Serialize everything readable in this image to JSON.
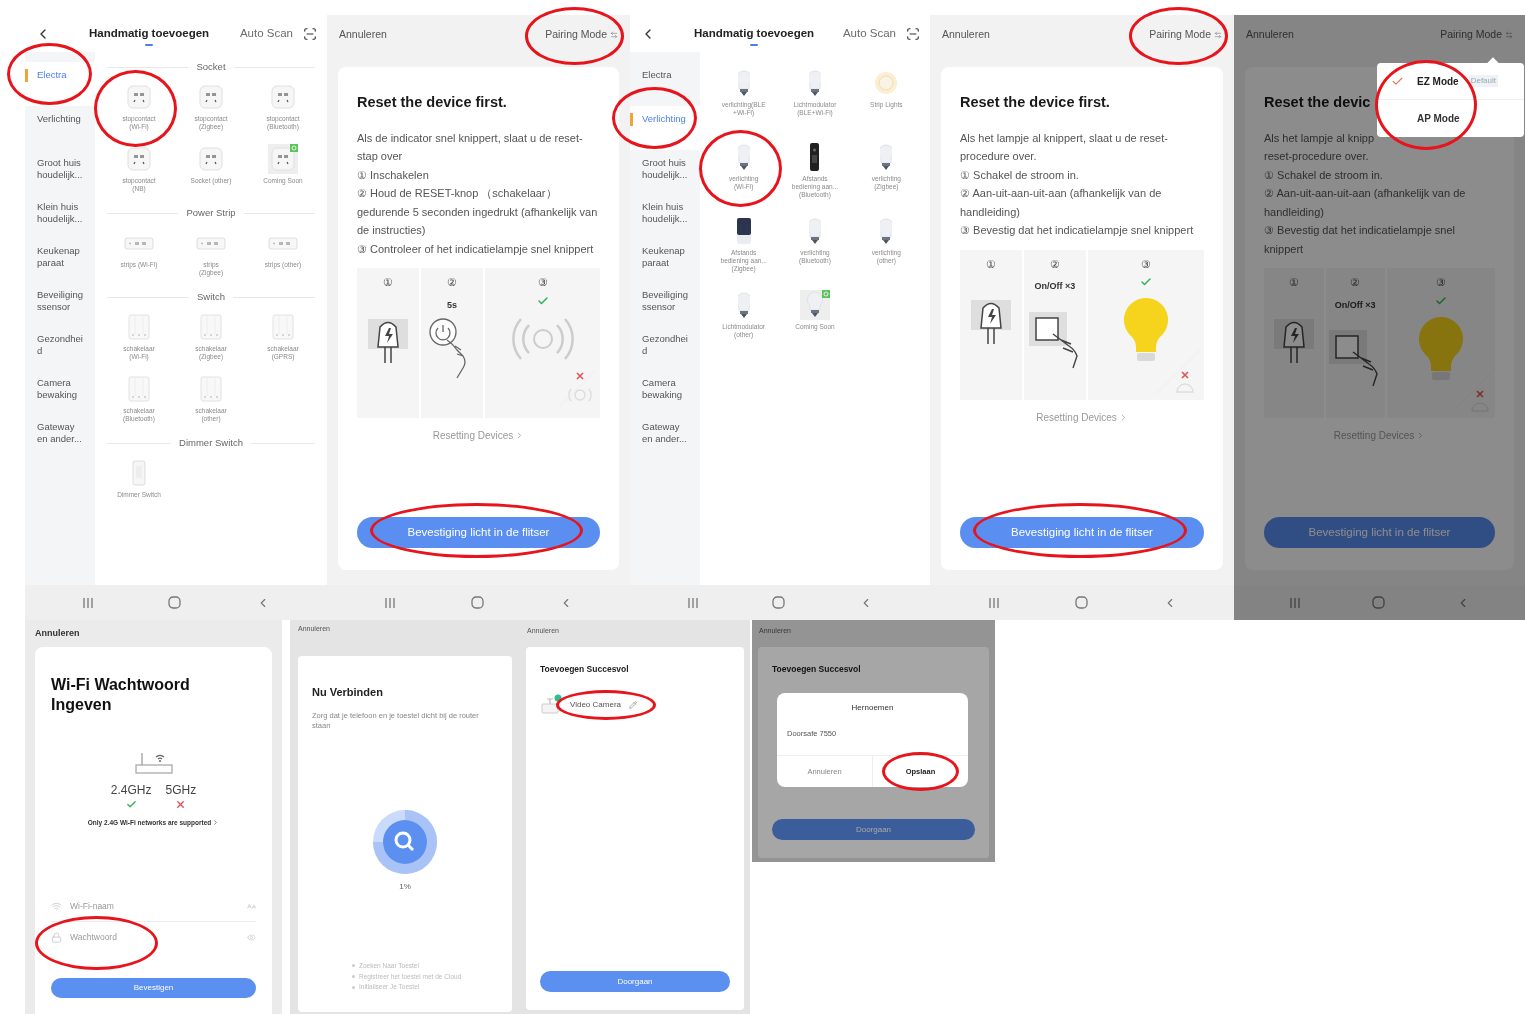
{
  "top_row": [
    {
      "kind": "category_list",
      "tabs": [
        {
          "label": "Handmatig toevoegen",
          "selected": true
        },
        {
          "label": "Auto Scan",
          "selected": false
        }
      ],
      "categories": [
        {
          "label": "Electra",
          "selected": true,
          "circled": true
        },
        {
          "label": "Verlichting",
          "selected": false
        },
        {
          "label": "Groot huis\nhoudelijk...",
          "selected": false
        },
        {
          "label": "Klein huis\nhoudelijk...",
          "selected": false
        },
        {
          "label": "Keukenap\nparaat",
          "selected": false
        },
        {
          "label": "Beveiliging\nssensor",
          "selected": false
        },
        {
          "label": "Gezondhei\nd",
          "selected": false
        },
        {
          "label": "Camera\nbewaking",
          "selected": false
        },
        {
          "label": "Gateway\nen ander...",
          "selected": false
        }
      ],
      "sections": [
        {
          "heading": "Socket",
          "items": [
            {
              "label": "stopcontact\n(Wi-Fi)",
              "kind": "socket",
              "circled": true
            },
            {
              "label": "stopcontact\n(Zigbee)",
              "kind": "socket"
            },
            {
              "label": "stopcontact\n(Bluetooth)",
              "kind": "socket"
            },
            {
              "label": "stopcontact\n(NB)",
              "kind": "socket"
            },
            {
              "label": "Socket (other)",
              "kind": "socket"
            },
            {
              "label": "Coming Soon",
              "kind": "socket",
              "coming_soon": true
            }
          ]
        },
        {
          "heading": "Power Strip",
          "items": [
            {
              "label": "strips (Wi-Fi)",
              "kind": "strip"
            },
            {
              "label": "strips\n(Zigbee)",
              "kind": "strip"
            },
            {
              "label": "strips (other)",
              "kind": "strip"
            }
          ]
        },
        {
          "heading": "Switch",
          "items": [
            {
              "label": "schakelaar\n(Wi-Fi)",
              "kind": "switch"
            },
            {
              "label": "schakelaar\n(Zigbee)",
              "kind": "switch"
            },
            {
              "label": "schakelaar\n(GPRS)",
              "kind": "switch"
            },
            {
              "label": "schakelaar\n(Bluetooth)",
              "kind": "switch"
            },
            {
              "label": "schakelaar\n(other)",
              "kind": "switch"
            }
          ]
        },
        {
          "heading": "Dimmer Switch",
          "items": [
            {
              "label": "Dimmer Switch",
              "kind": "dimmer"
            }
          ]
        }
      ]
    },
    {
      "kind": "reset_guide",
      "cancel": "Annuleren",
      "pairing_mode": {
        "label": "Pairing Mode",
        "circled": true
      },
      "title": "Reset the device first.",
      "lines": [
        "Als de indicator snel knippert, slaat u de reset-stap over",
        "① Inschakelen",
        "② Houd de RESET-knop （schakelaar） gedurende 5 seconden ingedrukt (afhankelijk van de instructies)",
        "③ Controleer of het indicatielampje snel knippert"
      ],
      "steps": [
        {
          "number": "①",
          "kind": "plug",
          "ok": false
        },
        {
          "number": "②",
          "caption": "5s",
          "kind": "power_press",
          "ok": false
        },
        {
          "number": "③",
          "kind": "signal_blink",
          "ok": true
        }
      ],
      "link": "Resetting Devices",
      "button": {
        "label": "Bevestiging licht in de flitser",
        "circled": true
      }
    },
    {
      "kind": "category_list",
      "tabs": [
        {
          "label": "Handmatig toevoegen",
          "selected": true
        },
        {
          "label": "Auto Scan",
          "selected": false
        }
      ],
      "categories": [
        {
          "label": "Electra",
          "selected": false
        },
        {
          "label": "Verlichting",
          "selected": true,
          "circled": true
        },
        {
          "label": "Groot huis\nhoudelijk...",
          "selected": false
        },
        {
          "label": "Klein huis\nhoudelijk...",
          "selected": false
        },
        {
          "label": "Keukenap\nparaat",
          "selected": false
        },
        {
          "label": "Beveiliging\nssensor",
          "selected": false
        },
        {
          "label": "Gezondhei\nd",
          "selected": false
        },
        {
          "label": "Camera\nbewaking",
          "selected": false
        },
        {
          "label": "Gateway\nen ander...",
          "selected": false
        }
      ],
      "sections": [
        {
          "items": [
            {
              "label": "verlichting(BLE\n+Wi-Fi)",
              "kind": "bulb"
            },
            {
              "label": "Lichtmodulator\n(BLE+Wi-Fi)",
              "kind": "bulb"
            },
            {
              "label": "Strip Lights",
              "kind": "strip_light"
            },
            {
              "label": "verlichting\n(Wi-Fi)",
              "kind": "bulb",
              "circled": true
            },
            {
              "label": "Afstands\nbediening aan...\n(Bluetooth)",
              "kind": "remote"
            },
            {
              "label": "verlichting\n(Zigbee)",
              "kind": "bulb"
            },
            {
              "label": "Afstands\nbediening aan...\n(Zigbee)",
              "kind": "remote_tablet"
            },
            {
              "label": "verlichting\n(Bluetooth)",
              "kind": "bulb"
            },
            {
              "label": "verlichting\n(other)",
              "kind": "bulb"
            },
            {
              "label": "Lichtmodulator\n(other)",
              "kind": "bulb"
            },
            {
              "label": "Coming Soon",
              "kind": "bulb",
              "coming_soon": true
            }
          ]
        }
      ]
    },
    {
      "kind": "reset_guide",
      "cancel": "Annuleren",
      "pairing_mode": {
        "label": "Pairing Mode",
        "circled": true
      },
      "title": "Reset the device first.",
      "lines": [
        "Als het lampje al knippert, slaat u de reset-procedure over.",
        "① Schakel de stroom in.",
        "② Aan-uit-aan-uit-aan (afhankelijk van de handleiding)",
        "③ Bevestig dat het indicatielampje snel knippert"
      ],
      "steps": [
        {
          "number": "①",
          "kind": "plug",
          "ok": false
        },
        {
          "number": "②",
          "caption": "On/Off ×3",
          "kind": "switch_press",
          "ok": false
        },
        {
          "number": "③",
          "kind": "bulb_blink",
          "ok": true
        }
      ],
      "link": "Resetting Devices",
      "button": {
        "label": "Bevestiging licht in de flitser",
        "circled": true
      }
    },
    {
      "kind": "reset_guide",
      "cancel": "Annuleren",
      "pairing_mode": {
        "label": "Pairing Mode"
      },
      "title": "Reset the devic",
      "lines": [
        "Als het lampje al knipp",
        "reset-procedure over.",
        "① Schakel de stroom in.",
        "② Aan-uit-aan-uit-aan (afhankelijk van de handleiding)",
        "③ Bevestig dat het indicatielampje snel knippert"
      ],
      "steps": [
        {
          "number": "①",
          "kind": "plug",
          "ok": false
        },
        {
          "number": "②",
          "caption": "On/Off ×3",
          "kind": "switch_press",
          "ok": false
        },
        {
          "number": "③",
          "kind": "bulb_blink",
          "ok": true
        }
      ],
      "link": "Resetting Devices",
      "button": {
        "label": "Bevestiging licht in de flitser"
      },
      "dimmed": true,
      "menu": {
        "circled": true,
        "items": [
          {
            "label": "EZ Mode",
            "selected": true,
            "badge": "Default"
          },
          {
            "label": "AP Mode",
            "selected": false
          }
        ]
      }
    }
  ],
  "bottom_row": [
    {
      "kind": "wifi_password",
      "cancel": "Annuleren",
      "title": "Wi-Fi Wachtwoord Ingeven",
      "bands": [
        {
          "label": "2.4GHz",
          "supported": true
        },
        {
          "label": "5GHz",
          "supported": false
        }
      ],
      "note": "Only 2.4G Wi-Fi networks are supported",
      "name_field": {
        "placeholder": "Wi-Fi-naam"
      },
      "password_field": {
        "placeholder": "Wachtwoord",
        "circled": true
      },
      "button": "Bevestigen"
    },
    {
      "kind": "connecting",
      "cancel": "Annuleren",
      "title": "Nu Verbinden",
      "subtitle": "Zorg dat je telefoon en je toestel dicht bij de router staan",
      "progress": "1%",
      "steps": [
        "Zoeken Naar Toestel",
        "Registreer het toestel met de Cloud",
        "Initialiseer Je Toestel"
      ]
    },
    {
      "kind": "success",
      "cancel": "Annuleren",
      "title": "Toevoegen Succesvol",
      "device": {
        "name": "Video Camera",
        "circled": true
      },
      "button": "Doorgaan"
    },
    {
      "kind": "success",
      "cancel": "Annuleren",
      "title": "Toevoegen Succesvol",
      "button": "Doorgaan",
      "dimmed": true,
      "dialog": {
        "title": "Hernoemen",
        "value": "Doorsafe 7550",
        "cancel": "Annuleren",
        "confirm": {
          "label": "Opslaan",
          "circled": true
        }
      }
    }
  ]
}
